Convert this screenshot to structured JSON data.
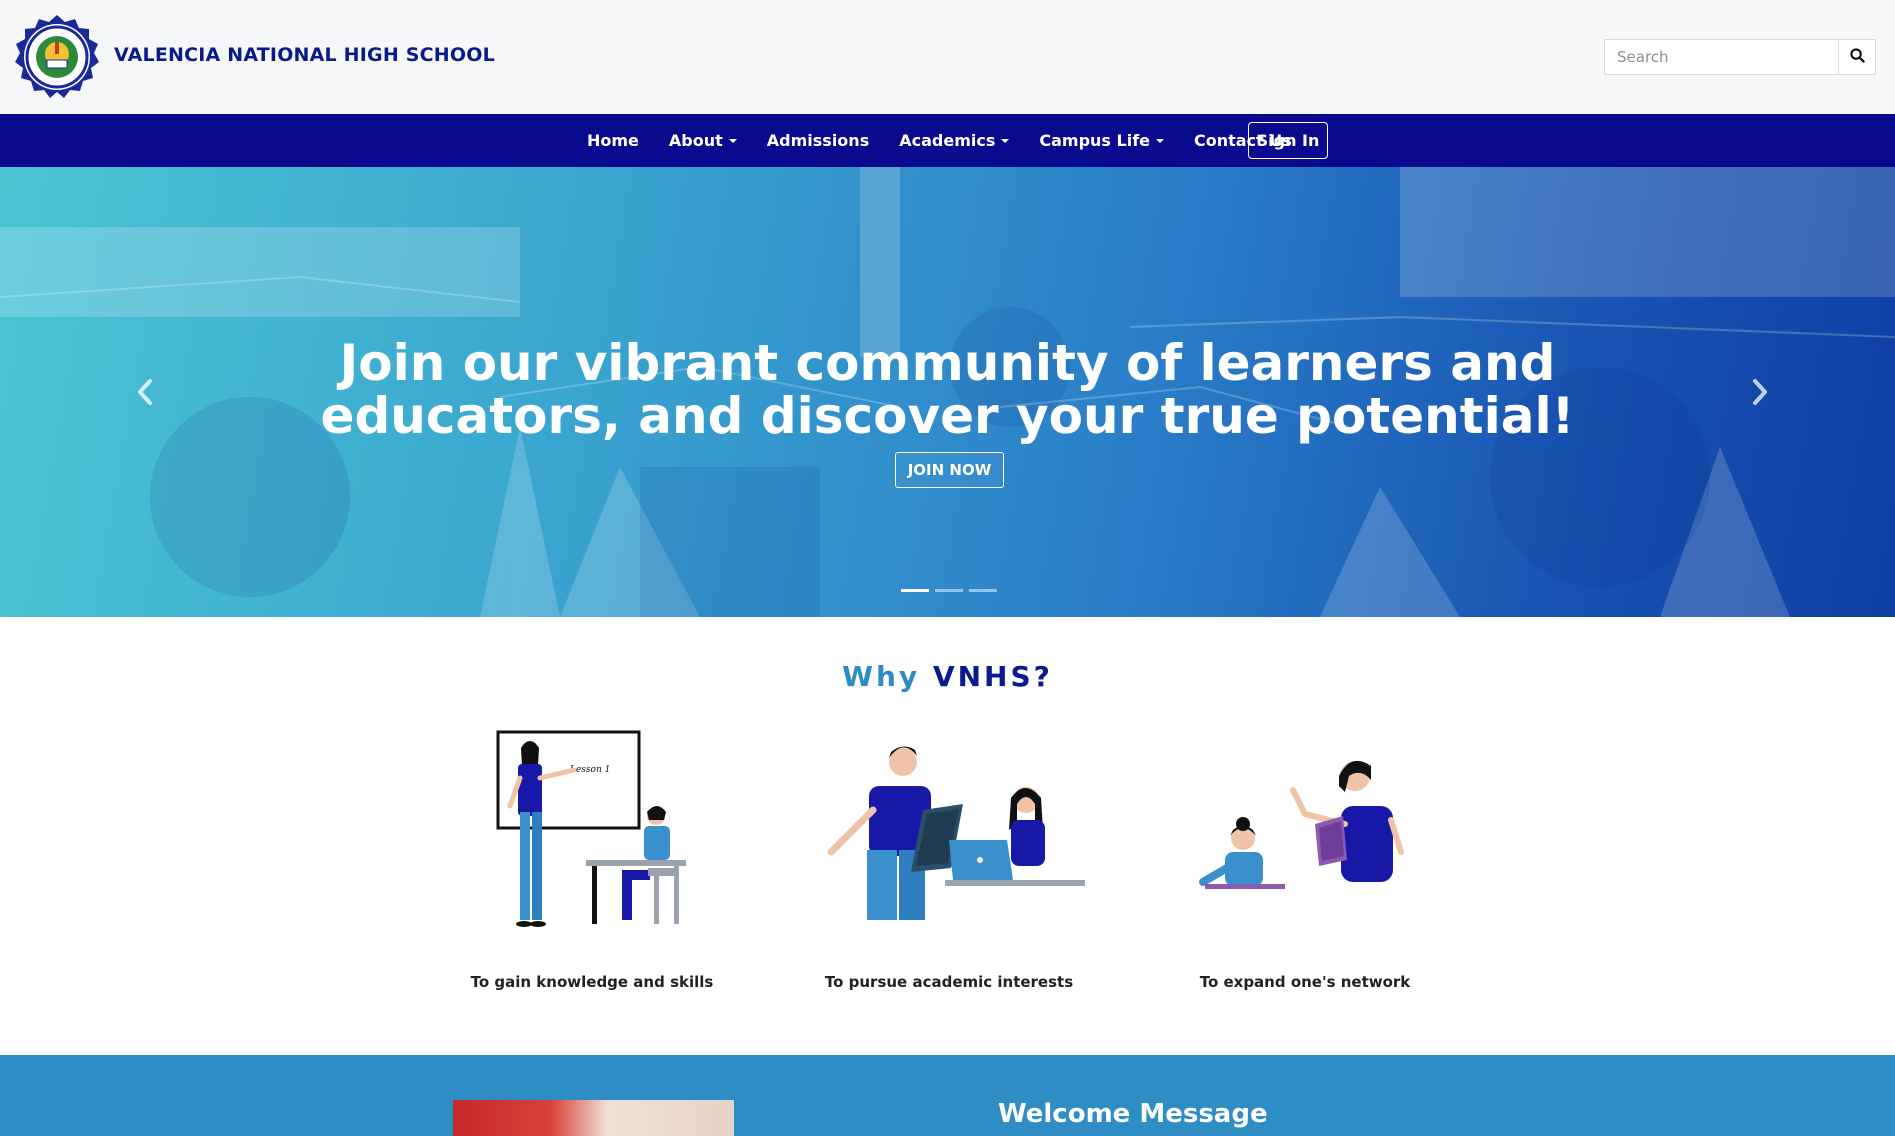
{
  "header": {
    "school_name": "VALENCIA NATIONAL HIGH SCHOOL",
    "logo_icon": "school-seal-logo",
    "search": {
      "placeholder": "Search",
      "value": "",
      "icon": "search-icon"
    }
  },
  "nav": {
    "items": [
      {
        "label": "Home",
        "dropdown": false
      },
      {
        "label": "About",
        "dropdown": true
      },
      {
        "label": "Admissions",
        "dropdown": false
      },
      {
        "label": "Academics",
        "dropdown": true
      },
      {
        "label": "Campus Life",
        "dropdown": true
      },
      {
        "label": "Contact Us",
        "dropdown": false
      }
    ],
    "signin_label": "Sign In"
  },
  "hero": {
    "title_line1": "Join our vibrant community of learners and",
    "title_line2": "educators, and discover your true potential!",
    "button_label": "JOIN NOW",
    "slide_count": 3,
    "active_slide": 1
  },
  "why": {
    "title_part1": "Why",
    "title_part2": "VNHS?",
    "illustration_board_text": "Lesson 1",
    "cards": [
      {
        "caption": "To gain knowledge and skills",
        "illustration": "teacher-whiteboard-illustration"
      },
      {
        "caption": "To pursue academic interests",
        "illustration": "students-tablet-laptop-illustration"
      },
      {
        "caption": "To expand one's network",
        "illustration": "teacher-student-book-illustration"
      }
    ]
  },
  "welcome": {
    "title": "Welcome Message"
  },
  "colors": {
    "nav_bg": "#0a0a8f",
    "brand_blue": "#0a1a8c",
    "accent_light_blue": "#2e8bc6",
    "section_blue": "#2e8dc5"
  }
}
